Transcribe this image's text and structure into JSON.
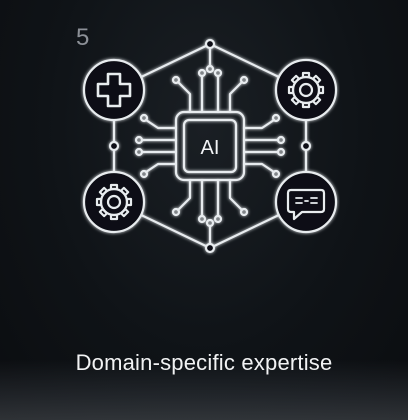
{
  "card": {
    "number": "5",
    "chip_label": "AI",
    "caption": "Domain-specific expertise"
  },
  "icons": [
    "plus-icon",
    "gear-icon",
    "chat-icon"
  ],
  "colors": {
    "background": "#0e1114",
    "line": "#e8ecef",
    "number": "#8c9097"
  }
}
